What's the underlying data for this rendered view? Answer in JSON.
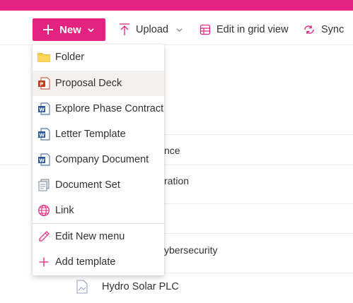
{
  "command_bar": {
    "new_label": "New",
    "upload_label": "Upload",
    "grid_label": "Edit in grid view",
    "sync_label": "Sync"
  },
  "new_menu": {
    "items": [
      {
        "label": "Folder",
        "icon": "folder-icon"
      },
      {
        "label": "Proposal Deck",
        "icon": "powerpoint-icon"
      },
      {
        "label": "Explore Phase Contract",
        "icon": "word-icon"
      },
      {
        "label": "Letter Template",
        "icon": "word-icon"
      },
      {
        "label": "Company Document",
        "icon": "word-icon"
      },
      {
        "label": "Document Set",
        "icon": "document-set-icon"
      },
      {
        "label": "Link",
        "icon": "globe-icon"
      }
    ],
    "footer": [
      {
        "label": "Edit New menu",
        "icon": "pencil-icon"
      },
      {
        "label": "Add template",
        "icon": "plus-icon"
      }
    ]
  },
  "list": {
    "rows": [
      "nce",
      "ration",
      "ybersecurity"
    ],
    "last_row": "Hydro Solar PLC"
  },
  "colors": {
    "accent": "#e3237f",
    "word": "#2b579a",
    "powerpoint": "#c43e1c",
    "folder": "#ffc83d"
  }
}
